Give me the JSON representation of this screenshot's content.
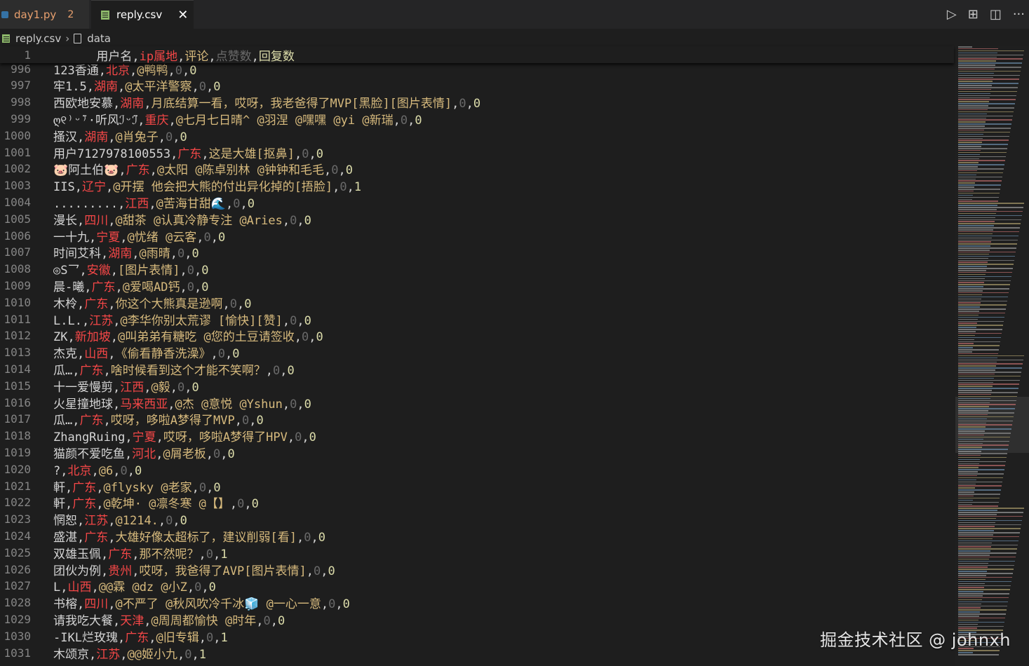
{
  "tabs": {
    "day1": {
      "label": "day1.py",
      "count": "2"
    },
    "reply": {
      "label": "reply.csv",
      "close": "✕"
    }
  },
  "actions": {
    "run": "▷",
    "preview": "⊞",
    "split": "◫",
    "more": "···"
  },
  "breadcrumb": {
    "file": "reply.csv",
    "sep": "›",
    "section": "data"
  },
  "header_row": {
    "line_number": "1",
    "fields": [
      "用户名",
      "ip属地",
      "评论",
      "点赞数",
      "回复数"
    ]
  },
  "rows": [
    {
      "n": "996",
      "user": "123香通",
      "ip": "北京",
      "comment": "@鸭鸭",
      "likes": "0",
      "replies": "0"
    },
    {
      "n": "997",
      "user": "牢1.5",
      "ip": "湖南",
      "comment": "@太平洋警察",
      "likes": "0",
      "replies": "0"
    },
    {
      "n": "998",
      "user": "西欧地安慕",
      "ip": "湖南",
      "comment": "月底结算一看，哎呀，我老爸得了MVP[黑脸][图片表情]",
      "likes": "0",
      "replies": "0"
    },
    {
      "n": "999",
      "user": "ღ୧⁾ᵕ̈⁾·听风ℐᵕ̈ℐ",
      "ip": "重庆",
      "comment": "@七月七日晴^ @羽涅 @嘿嘿 @yi @新瑞",
      "likes": "0",
      "replies": "0"
    },
    {
      "n": "1000",
      "user": "搔汉",
      "ip": "湖南",
      "comment": "@肖兔子",
      "likes": "0",
      "replies": "0"
    },
    {
      "n": "1001",
      "user": "用户7127978100553",
      "ip": "广东",
      "comment": "这是大雄[抠鼻]",
      "likes": "0",
      "replies": "0"
    },
    {
      "n": "1002",
      "user": "🐷阿土伯🐷",
      "ip": "广东",
      "comment": "@太阳 @陈卓别林 @钟钟和毛毛",
      "likes": "0",
      "replies": "0"
    },
    {
      "n": "1003",
      "user": "IIS",
      "ip": "辽宁",
      "comment": "@开摆 他会把大熊的付出异化掉的[捂脸]",
      "likes": "0",
      "replies": "1"
    },
    {
      "n": "1004",
      "user": ".........",
      "ip": "江西",
      "comment": "@苦海甘甜🌊",
      "likes": "0",
      "replies": "0"
    },
    {
      "n": "1005",
      "user": "漫长",
      "ip": "四川",
      "comment": "@甜茶 @认真冷静专注 @Aries",
      "likes": "0",
      "replies": "0"
    },
    {
      "n": "1006",
      "user": "一十九",
      "ip": "宁夏",
      "comment": "@忧绪 @云客",
      "likes": "0",
      "replies": "0"
    },
    {
      "n": "1007",
      "user": "时间艾科",
      "ip": "湖南",
      "comment": "@雨晴",
      "likes": "0",
      "replies": "0"
    },
    {
      "n": "1008",
      "user": "◎S乛",
      "ip": "安徽",
      "comment": "[图片表情]",
      "likes": "0",
      "replies": "0"
    },
    {
      "n": "1009",
      "user": "晨-曦",
      "ip": "广东",
      "comment": "@爱喝AD钙",
      "likes": "0",
      "replies": "0"
    },
    {
      "n": "1010",
      "user": "木柃",
      "ip": "广东",
      "comment": "你这个大熊真是逊啊",
      "likes": "0",
      "replies": "0"
    },
    {
      "n": "1011",
      "user": "L.L.",
      "ip": "江苏",
      "comment": "@李华你别太荒谬 [愉快][赞]",
      "likes": "0",
      "replies": "0"
    },
    {
      "n": "1012",
      "user": "ZK",
      "ip": "新加坡",
      "comment": "@叫弟弟有糖吃 @您的土豆请签收",
      "likes": "0",
      "replies": "0"
    },
    {
      "n": "1013",
      "user": "杰克",
      "ip": "山西",
      "comment": "《偷看静香洗澡》",
      "likes": "0",
      "replies": "0"
    },
    {
      "n": "1014",
      "user": "瓜…",
      "ip": "广东",
      "comment": "啥时候看到这个才能不笑啊？",
      "likes": "0",
      "replies": "0"
    },
    {
      "n": "1015",
      "user": "十一爱慢剪",
      "ip": "江西",
      "comment": "@毅",
      "likes": "0",
      "replies": "0"
    },
    {
      "n": "1016",
      "user": "火星撞地球",
      "ip": "马来西亚",
      "comment": "@杰 @意悦 @Yshun",
      "likes": "0",
      "replies": "0"
    },
    {
      "n": "1017",
      "user": "瓜…",
      "ip": "广东",
      "comment": "哎呀，哆啦A梦得了MVP",
      "likes": "0",
      "replies": "0"
    },
    {
      "n": "1018",
      "user": "ZhangRuing",
      "ip": "宁夏",
      "comment": "哎呀，哆啦A梦得了HPV",
      "likes": "0",
      "replies": "0"
    },
    {
      "n": "1019",
      "user": "猫颜不爱吃鱼",
      "ip": "河北",
      "comment": "@屑老板",
      "likes": "0",
      "replies": "0"
    },
    {
      "n": "1020",
      "user": "?",
      "ip": "北京",
      "comment": "@6",
      "likes": "0",
      "replies": "0"
    },
    {
      "n": "1021",
      "user": "軒",
      "ip": "广东",
      "comment": "@flysky @老家",
      "likes": "0",
      "replies": "0"
    },
    {
      "n": "1022",
      "user": "軒",
      "ip": "广东",
      "comment": "@乾坤· @凛冬寒 @【】",
      "likes": "0",
      "replies": "0"
    },
    {
      "n": "1023",
      "user": "惘恕",
      "ip": "江苏",
      "comment": "@1214.",
      "likes": "0",
      "replies": "0"
    },
    {
      "n": "1024",
      "user": "盛湛",
      "ip": "广东",
      "comment": "大雄好像太超标了，建议削弱[看]",
      "likes": "0",
      "replies": "0"
    },
    {
      "n": "1025",
      "user": "双雄玉佩",
      "ip": "广东",
      "comment": "那不然呢？",
      "likes": "0",
      "replies": "1"
    },
    {
      "n": "1026",
      "user": "团伙为例",
      "ip": "贵州",
      "comment": "哎呀，我爸得了AVP[图片表情]",
      "likes": "0",
      "replies": "0"
    },
    {
      "n": "1027",
      "user": "L",
      "ip": "山西",
      "comment": "@@霖 @dz @小Z",
      "likes": "0",
      "replies": "0"
    },
    {
      "n": "1028",
      "user": "书榕",
      "ip": "四川",
      "comment": "@不严了 @秋风吹冷千冰🧊 @一心一意",
      "likes": "0",
      "replies": "0"
    },
    {
      "n": "1029",
      "user": "请我吃大餐",
      "ip": "天津",
      "comment": "@周周都愉快 @时年",
      "likes": "0",
      "replies": "0"
    },
    {
      "n": "1030",
      "user": "-IKL烂玫瑰",
      "ip": "广东",
      "comment": "@旧专辑",
      "likes": "0",
      "replies": "1"
    },
    {
      "n": "1031",
      "user": "木颂京",
      "ip": "江苏",
      "comment": "@@姬小九",
      "likes": "0",
      "replies": "1"
    }
  ],
  "colors": {
    "background": "#1e1e1e",
    "ip": "#f44747",
    "comment": "#d7ba7d",
    "likes": "#6a6a6a",
    "replies": "#dcdcaa"
  },
  "watermark": "掘金技术社区 @ johnxh"
}
